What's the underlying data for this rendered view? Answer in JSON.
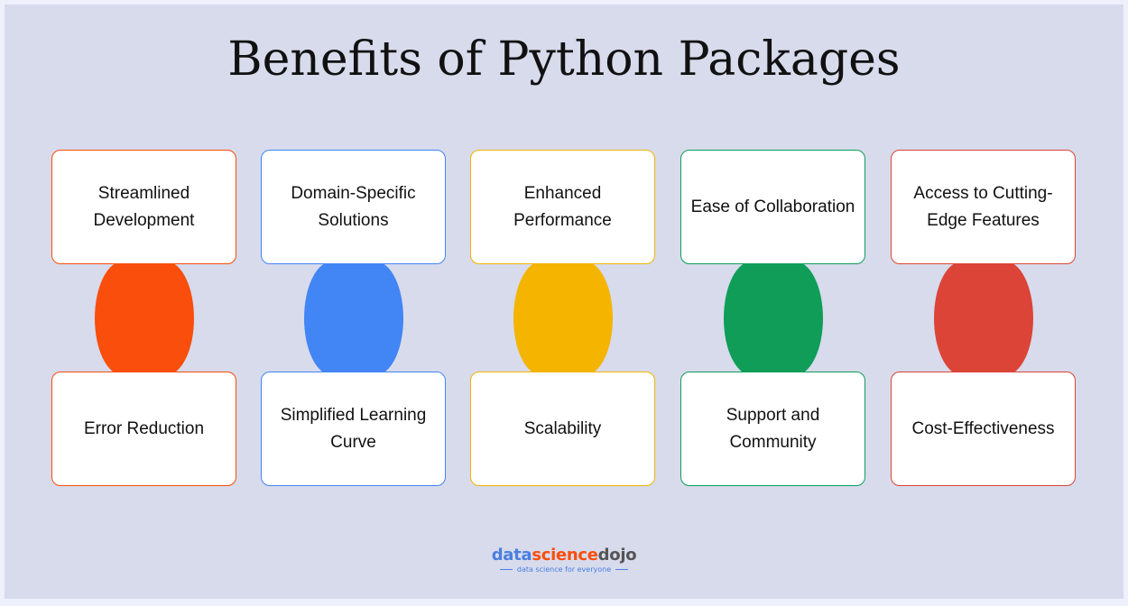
{
  "title": "Benefits of Python Packages",
  "columns": [
    {
      "color": "#f94e0c",
      "top": "Streamlined Development",
      "bottom": "Error Reduction"
    },
    {
      "color": "#4285f4",
      "top": "Domain-Specific Solutions",
      "bottom": "Simplified Learning Curve"
    },
    {
      "color": "#f4b400",
      "top": "Enhanced Performance",
      "bottom": "Scalability"
    },
    {
      "color": "#0f9d58",
      "top": "Ease of Collaboration",
      "bottom": "Support and Community"
    },
    {
      "color": "#db4437",
      "top": "Access to Cutting-Edge Features",
      "bottom": "Cost-Effectiveness"
    }
  ],
  "logo": {
    "part1": "data",
    "part2": "science",
    "part3": "dojo",
    "tagline": "data science for everyone",
    "colors": {
      "blue": "#4a7fe0",
      "orange": "#f94e0c",
      "gray": "#555555"
    }
  }
}
